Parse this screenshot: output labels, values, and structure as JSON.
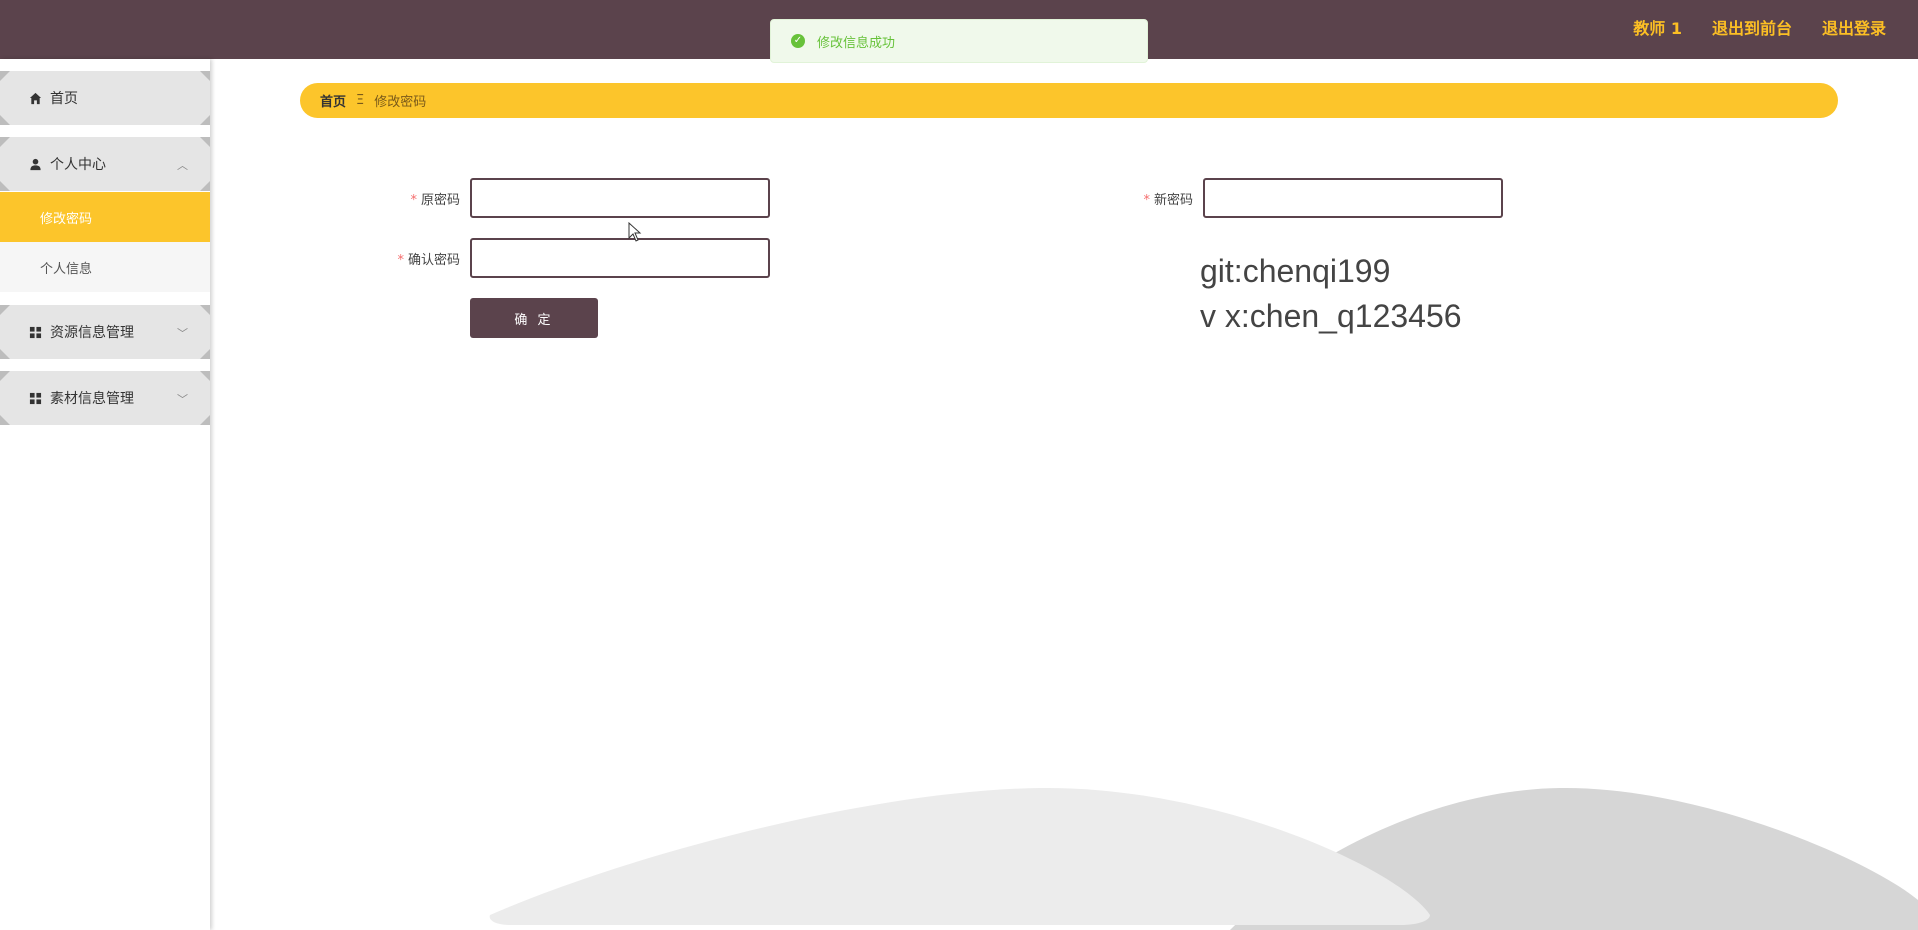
{
  "header": {
    "links": [
      "教师 1",
      "退出到前台",
      "退出登录"
    ],
    "background": "#5b434c",
    "accent": "#fcbf24"
  },
  "toast": {
    "message": "修改信息成功",
    "icon": "check-circle-icon",
    "color": "#67c23a"
  },
  "sidebar": {
    "items": [
      {
        "label": "首页",
        "icon": "home-icon"
      },
      {
        "label": "个人中心",
        "icon": "user-icon",
        "expanded": true,
        "children": [
          {
            "label": "修改密码",
            "active": true
          },
          {
            "label": "个人信息",
            "active": false
          }
        ]
      },
      {
        "label": "资源信息管理",
        "icon": "grid-icon",
        "expanded": false
      },
      {
        "label": "素材信息管理",
        "icon": "grid-icon",
        "expanded": false
      }
    ]
  },
  "breadcrumb": {
    "home": "首页",
    "separator": "Ξ",
    "current": "修改密码"
  },
  "form": {
    "old_password_label": "原密码",
    "new_password_label": "新密码",
    "confirm_password_label": "确认密码",
    "required_mark": "*",
    "submit_label": "确 定"
  },
  "watermark": {
    "line1": "git:chenqi199",
    "line2": "v x:chen_q123456"
  }
}
